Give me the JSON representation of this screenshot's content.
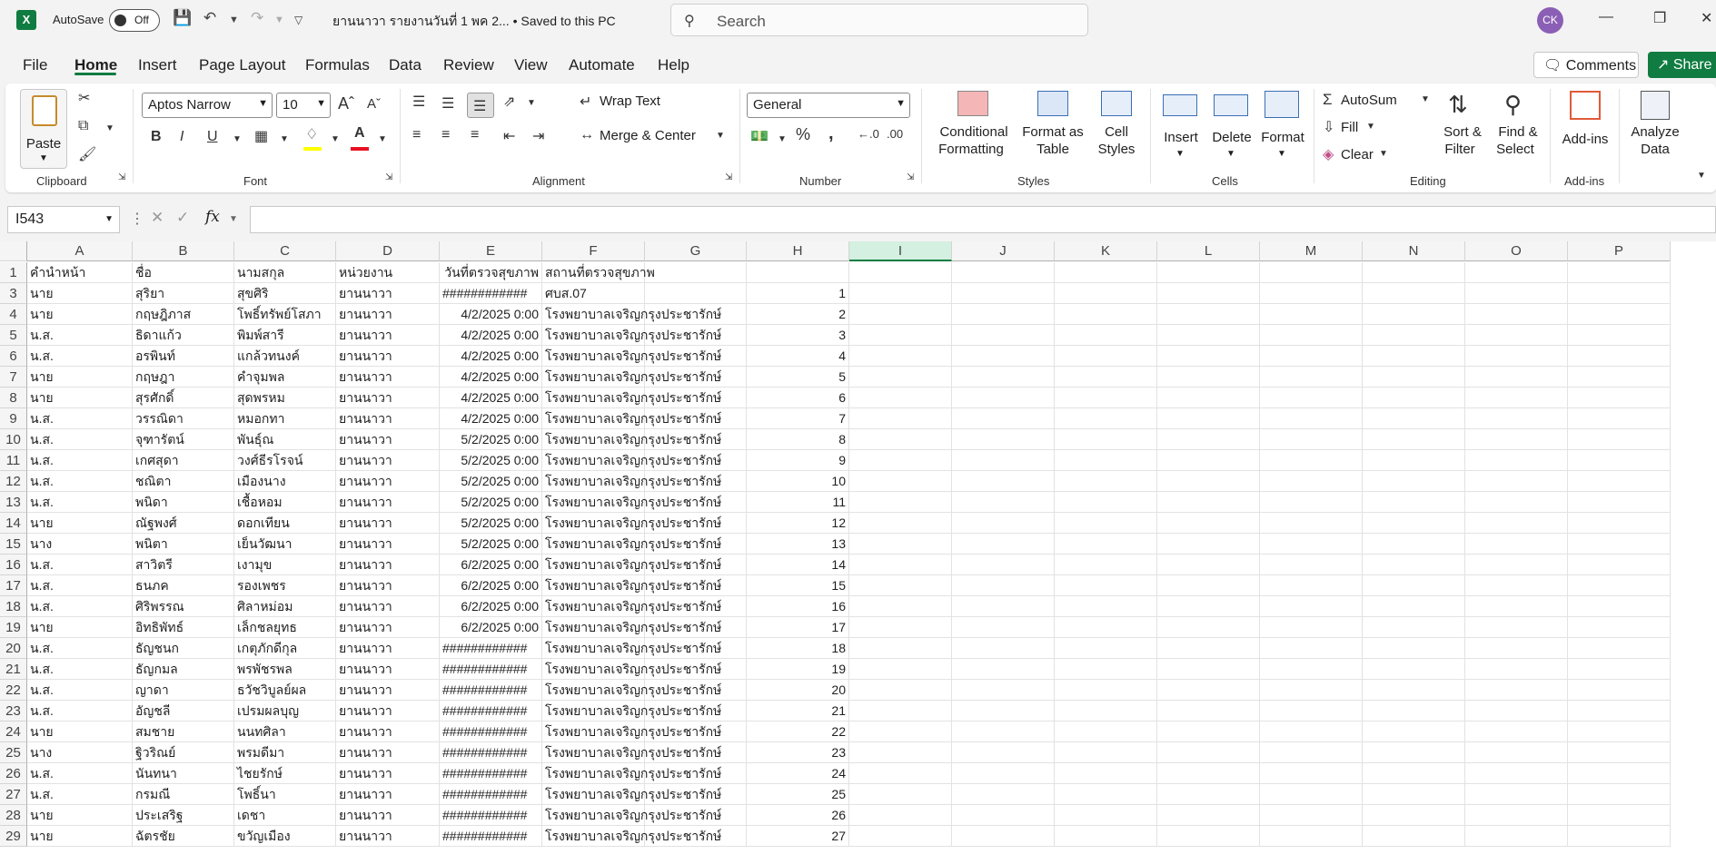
{
  "title_bar": {
    "autosave_label": "AutoSave",
    "autosave_state": "Off",
    "document_title": "ยานนาวา รายงานวันที่ 1 พค 2...  • Saved to this PC",
    "search_placeholder": "Search",
    "user_initials": "CK"
  },
  "menu": {
    "items": [
      "File",
      "Home",
      "Insert",
      "Page Layout",
      "Formulas",
      "Data",
      "Review",
      "View",
      "Automate",
      "Help"
    ],
    "active": "Home",
    "comments_label": "Comments",
    "share_label": "Share"
  },
  "ribbon": {
    "clipboard": {
      "paste": "Paste",
      "group": "Clipboard"
    },
    "font": {
      "name": "Aptos Narrow",
      "size": "10",
      "bold": "B",
      "italic": "I",
      "underline": "U",
      "group": "Font"
    },
    "alignment": {
      "wrap_text": "Wrap Text",
      "merge_center": "Merge & Center",
      "group": "Alignment"
    },
    "number": {
      "format": "General",
      "group": "Number"
    },
    "styles": {
      "conditional": "Conditional",
      "formatting": "Formatting",
      "format_as": "Format as",
      "table": "Table",
      "cell": "Cell",
      "styles_word": "Styles",
      "group": "Styles"
    },
    "cells": {
      "insert": "Insert",
      "delete": "Delete",
      "format": "Format",
      "group": "Cells"
    },
    "editing": {
      "autosum": "AutoSum",
      "fill": "Fill",
      "clear": "Clear",
      "sort": "Sort &",
      "filter": "Filter",
      "find": "Find &",
      "select": "Select",
      "group": "Editing"
    },
    "addins": {
      "addins": "Add-ins",
      "group": "Add-ins"
    },
    "analyze": {
      "line1": "Analyze",
      "line2": "Data"
    },
    "colors": {
      "accent": "#107c41",
      "fill_yellow": "#ffff00",
      "font_red": "#e81123"
    }
  },
  "formula_bar": {
    "name_box": "I543",
    "fx": "fx",
    "formula": ""
  },
  "sheet": {
    "columns": [
      "A",
      "B",
      "C",
      "D",
      "E",
      "F",
      "G",
      "H",
      "I",
      "J",
      "K",
      "L",
      "M",
      "N",
      "O",
      "P"
    ],
    "selected_column": "I",
    "header_row": {
      "row": "1",
      "a": "คำนำหน้า",
      "b": "ชื่อ",
      "c": "นามสกุล",
      "d": "หน่วยงาน",
      "e": "วันที่ตรวจสุขภาพ",
      "f": "สถานที่ตรวจสุขภาพ"
    },
    "rows": [
      {
        "row": "3",
        "a": "นาย",
        "b": "สุริยา",
        "c": "สุขศิริ",
        "d": "ยานนาวา",
        "e": "############",
        "f": "ศบส.07",
        "h": "1"
      },
      {
        "row": "4",
        "a": "นาย",
        "b": "กฤษฎิภาส",
        "c": "โพธิ์ทรัพย์โสภา",
        "d": "ยานนาวา",
        "e": "4/2/2025 0:00",
        "f": "โรงพยาบาลเจริญกรุงประชารักษ์",
        "h": "2"
      },
      {
        "row": "5",
        "a": "น.ส.",
        "b": "ธิดาแก้ว",
        "c": "พิมพ์สารี",
        "d": "ยานนาวา",
        "e": "4/2/2025 0:00",
        "f": "โรงพยาบาลเจริญกรุงประชารักษ์",
        "h": "3"
      },
      {
        "row": "6",
        "a": "น.ส.",
        "b": "อรพินท์",
        "c": "แกล้วทนงค์",
        "d": "ยานนาวา",
        "e": "4/2/2025 0:00",
        "f": "โรงพยาบาลเจริญกรุงประชารักษ์",
        "h": "4"
      },
      {
        "row": "7",
        "a": "นาย",
        "b": "กฤษฎา",
        "c": "คำจุมพล",
        "d": "ยานนาวา",
        "e": "4/2/2025 0:00",
        "f": "โรงพยาบาลเจริญกรุงประชารักษ์",
        "h": "5"
      },
      {
        "row": "8",
        "a": "นาย",
        "b": "สุรศักดิ์",
        "c": "สุดพรหม",
        "d": "ยานนาวา",
        "e": "4/2/2025 0:00",
        "f": "โรงพยาบาลเจริญกรุงประชารักษ์",
        "h": "6"
      },
      {
        "row": "9",
        "a": "น.ส.",
        "b": "วรรณิดา",
        "c": "หมอกทา",
        "d": "ยานนาวา",
        "e": "4/2/2025 0:00",
        "f": "โรงพยาบาลเจริญกรุงประชารักษ์",
        "h": "7"
      },
      {
        "row": "10",
        "a": "น.ส.",
        "b": "จุฑารัตน์",
        "c": "พันธุ์ณ",
        "d": "ยานนาวา",
        "e": "5/2/2025 0:00",
        "f": "โรงพยาบาลเจริญกรุงประชารักษ์",
        "h": "8"
      },
      {
        "row": "11",
        "a": "น.ส.",
        "b": "เกศสุดา",
        "c": "วงศ์ธีรโรจน์",
        "d": "ยานนาวา",
        "e": "5/2/2025 0:00",
        "f": "โรงพยาบาลเจริญกรุงประชารักษ์",
        "h": "9"
      },
      {
        "row": "12",
        "a": "น.ส.",
        "b": "ชณิตา",
        "c": "เมืองนาง",
        "d": "ยานนาวา",
        "e": "5/2/2025 0:00",
        "f": "โรงพยาบาลเจริญกรุงประชารักษ์",
        "h": "10"
      },
      {
        "row": "13",
        "a": "น.ส.",
        "b": "พนิดา",
        "c": "เชื้อหอม",
        "d": "ยานนาวา",
        "e": "5/2/2025 0:00",
        "f": "โรงพยาบาลเจริญกรุงประชารักษ์",
        "h": "11"
      },
      {
        "row": "14",
        "a": "นาย",
        "b": "ณัฐพงศ์",
        "c": "ดอกเทียน",
        "d": "ยานนาวา",
        "e": "5/2/2025 0:00",
        "f": "โรงพยาบาลเจริญกรุงประชารักษ์",
        "h": "12"
      },
      {
        "row": "15",
        "a": "นาง",
        "b": "พนิตา",
        "c": "เย็นวัฒนา",
        "d": "ยานนาวา",
        "e": "5/2/2025 0:00",
        "f": "โรงพยาบาลเจริญกรุงประชารักษ์",
        "h": "13"
      },
      {
        "row": "16",
        "a": "น.ส.",
        "b": "สาวิตรี",
        "c": "เงามุข",
        "d": "ยานนาวา",
        "e": "6/2/2025 0:00",
        "f": "โรงพยาบาลเจริญกรุงประชารักษ์",
        "h": "14"
      },
      {
        "row": "17",
        "a": "น.ส.",
        "b": "ธนภค",
        "c": "รองเพชร",
        "d": "ยานนาวา",
        "e": "6/2/2025 0:00",
        "f": "โรงพยาบาลเจริญกรุงประชารักษ์",
        "h": "15"
      },
      {
        "row": "18",
        "a": "น.ส.",
        "b": "ศิริพรรณ",
        "c": "ศิลาหม่อม",
        "d": "ยานนาวา",
        "e": "6/2/2025 0:00",
        "f": "โรงพยาบาลเจริญกรุงประชารักษ์",
        "h": "16"
      },
      {
        "row": "19",
        "a": "นาย",
        "b": "อิทธิพัทธ์",
        "c": "เล็กชลยุทธ",
        "d": "ยานนาวา",
        "e": "6/2/2025 0:00",
        "f": "โรงพยาบาลเจริญกรุงประชารักษ์",
        "h": "17"
      },
      {
        "row": "20",
        "a": "น.ส.",
        "b": "ธัญชนก",
        "c": "เกตุภักดีกุล",
        "d": "ยานนาวา",
        "e": "############",
        "f": "โรงพยาบาลเจริญกรุงประชารักษ์",
        "h": "18"
      },
      {
        "row": "21",
        "a": "น.ส.",
        "b": "ธัญกมล",
        "c": "พรพัชรพล",
        "d": "ยานนาวา",
        "e": "############",
        "f": "โรงพยาบาลเจริญกรุงประชารักษ์",
        "h": "19"
      },
      {
        "row": "22",
        "a": "น.ส.",
        "b": "ญาดา",
        "c": "ธวัชวิบูลย์ผล",
        "d": "ยานนาวา",
        "e": "############",
        "f": "โรงพยาบาลเจริญกรุงประชารักษ์",
        "h": "20"
      },
      {
        "row": "23",
        "a": "น.ส.",
        "b": "อัญชลี",
        "c": "เปรมผลบุญ",
        "d": "ยานนาวา",
        "e": "############",
        "f": "โรงพยาบาลเจริญกรุงประชารักษ์",
        "h": "21"
      },
      {
        "row": "24",
        "a": "นาย",
        "b": "สมชาย",
        "c": "นนทศิลา",
        "d": "ยานนาวา",
        "e": "############",
        "f": "โรงพยาบาลเจริญกรุงประชารักษ์",
        "h": "22"
      },
      {
        "row": "25",
        "a": "นาง",
        "b": "ฐิวริณย์",
        "c": "พรมดีมา",
        "d": "ยานนาวา",
        "e": "############",
        "f": "โรงพยาบาลเจริญกรุงประชารักษ์",
        "h": "23"
      },
      {
        "row": "26",
        "a": "น.ส.",
        "b": "นันทนา",
        "c": "ไชยรักษ์",
        "d": "ยานนาวา",
        "e": "############",
        "f": "โรงพยาบาลเจริญกรุงประชารักษ์",
        "h": "24"
      },
      {
        "row": "27",
        "a": "น.ส.",
        "b": "กรมณี",
        "c": "โพธิ์นา",
        "d": "ยานนาวา",
        "e": "############",
        "f": "โรงพยาบาลเจริญกรุงประชารักษ์",
        "h": "25"
      },
      {
        "row": "28",
        "a": "นาย",
        "b": "ประเสริฐ",
        "c": "เดชา",
        "d": "ยานนาวา",
        "e": "############",
        "f": "โรงพยาบาลเจริญกรุงประชารักษ์",
        "h": "26"
      },
      {
        "row": "29",
        "a": "นาย",
        "b": "ฉัตรชัย",
        "c": "ขวัญเมือง",
        "d": "ยานนาวา",
        "e": "############",
        "f": "โรงพยาบาลเจริญกรุงประชารักษ์",
        "h": "27"
      }
    ]
  }
}
